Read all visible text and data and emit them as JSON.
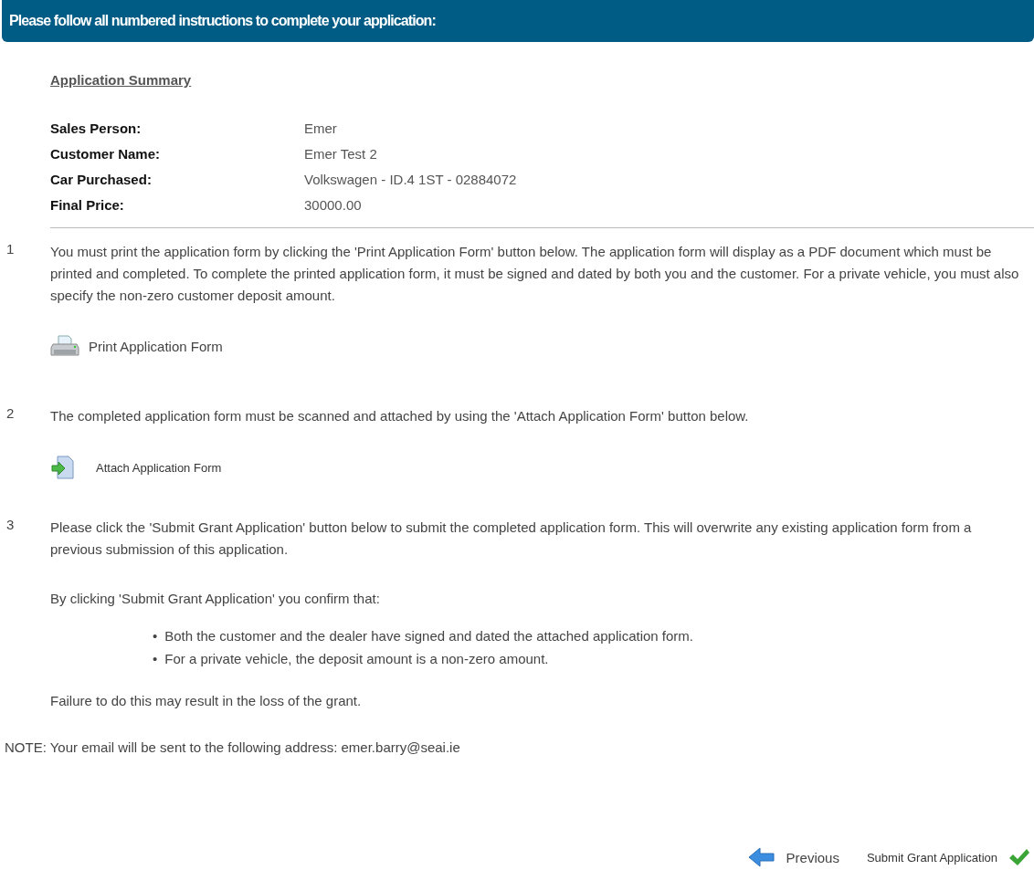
{
  "header": {
    "title": "Please follow all numbered instructions to complete your application:"
  },
  "summary": {
    "heading": "Application Summary",
    "rows": [
      {
        "label": "Sales Person:",
        "value": "Emer"
      },
      {
        "label": "Customer Name:",
        "value": "Emer Test 2"
      },
      {
        "label": "Car Purchased:",
        "value": "Volkswagen - ID.4 1ST - 02884072"
      },
      {
        "label": "Final Price:",
        "value": "30000.00"
      }
    ]
  },
  "steps": [
    {
      "number": "1",
      "blocks": [
        {
          "kind": "paragraph",
          "text": "You must print the application form by clicking the 'Print Application Form' button below. The application form will display as a PDF document which must be printed and completed. To complete the printed application form, it must be signed and dated by both you and the customer. For a private vehicle, you must also specify the non-zero customer deposit amount."
        },
        {
          "kind": "print",
          "label": "Print Application Form"
        }
      ]
    },
    {
      "number": "2",
      "blocks": [
        {
          "kind": "paragraph",
          "text": "The completed application form must be scanned and attached by using the 'Attach Application Form' button below."
        },
        {
          "kind": "attach",
          "label": "Attach Application Form"
        }
      ]
    },
    {
      "number": "3",
      "blocks": [
        {
          "kind": "paragraph",
          "text": "Please click the 'Submit Grant Application' button below to submit the completed application form. This will overwrite any existing application form from a previous submission of this application."
        },
        {
          "kind": "paragraph",
          "text": "By clicking 'Submit Grant Application' you confirm that:"
        },
        {
          "kind": "bullets",
          "items": [
            {
              "marker": "•",
              "text": "Both the customer and the dealer have signed and dated the attached application form."
            },
            {
              "marker": "•",
              "text": "For a private vehicle, the deposit amount is a non-zero amount."
            }
          ]
        },
        {
          "kind": "paragraph",
          "text": "Failure to do this may result in the loss of the grant."
        }
      ]
    }
  ],
  "note": "NOTE: Your email will be sent to the following address: emer.barry@seai.ie",
  "footer": {
    "previous": "Previous",
    "submit": "Submit Grant Application"
  }
}
